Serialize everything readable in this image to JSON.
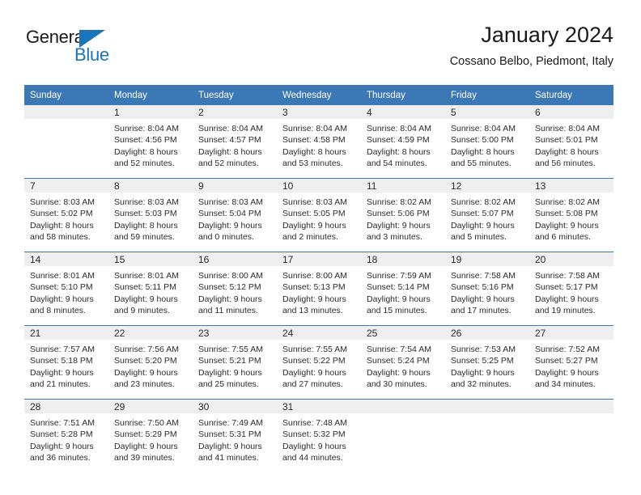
{
  "brand": {
    "name_top": "General",
    "name_bottom": "Blue",
    "accent_color": "#1b75bb"
  },
  "header": {
    "title": "January 2024",
    "subtitle": "Cossano Belbo, Piedmont, Italy"
  },
  "calendar": {
    "header_color": "#3b78b5",
    "daynum_background": "#efefef",
    "weekday_headers": [
      "Sunday",
      "Monday",
      "Tuesday",
      "Wednesday",
      "Thursday",
      "Friday",
      "Saturday"
    ],
    "weeks": [
      [
        {
          "day": "",
          "lines": []
        },
        {
          "day": "1",
          "lines": [
            "Sunrise: 8:04 AM",
            "Sunset: 4:56 PM",
            "Daylight: 8 hours",
            "and 52 minutes."
          ]
        },
        {
          "day": "2",
          "lines": [
            "Sunrise: 8:04 AM",
            "Sunset: 4:57 PM",
            "Daylight: 8 hours",
            "and 52 minutes."
          ]
        },
        {
          "day": "3",
          "lines": [
            "Sunrise: 8:04 AM",
            "Sunset: 4:58 PM",
            "Daylight: 8 hours",
            "and 53 minutes."
          ]
        },
        {
          "day": "4",
          "lines": [
            "Sunrise: 8:04 AM",
            "Sunset: 4:59 PM",
            "Daylight: 8 hours",
            "and 54 minutes."
          ]
        },
        {
          "day": "5",
          "lines": [
            "Sunrise: 8:04 AM",
            "Sunset: 5:00 PM",
            "Daylight: 8 hours",
            "and 55 minutes."
          ]
        },
        {
          "day": "6",
          "lines": [
            "Sunrise: 8:04 AM",
            "Sunset: 5:01 PM",
            "Daylight: 8 hours",
            "and 56 minutes."
          ]
        }
      ],
      [
        {
          "day": "7",
          "lines": [
            "Sunrise: 8:03 AM",
            "Sunset: 5:02 PM",
            "Daylight: 8 hours",
            "and 58 minutes."
          ]
        },
        {
          "day": "8",
          "lines": [
            "Sunrise: 8:03 AM",
            "Sunset: 5:03 PM",
            "Daylight: 8 hours",
            "and 59 minutes."
          ]
        },
        {
          "day": "9",
          "lines": [
            "Sunrise: 8:03 AM",
            "Sunset: 5:04 PM",
            "Daylight: 9 hours",
            "and 0 minutes."
          ]
        },
        {
          "day": "10",
          "lines": [
            "Sunrise: 8:03 AM",
            "Sunset: 5:05 PM",
            "Daylight: 9 hours",
            "and 2 minutes."
          ]
        },
        {
          "day": "11",
          "lines": [
            "Sunrise: 8:02 AM",
            "Sunset: 5:06 PM",
            "Daylight: 9 hours",
            "and 3 minutes."
          ]
        },
        {
          "day": "12",
          "lines": [
            "Sunrise: 8:02 AM",
            "Sunset: 5:07 PM",
            "Daylight: 9 hours",
            "and 5 minutes."
          ]
        },
        {
          "day": "13",
          "lines": [
            "Sunrise: 8:02 AM",
            "Sunset: 5:08 PM",
            "Daylight: 9 hours",
            "and 6 minutes."
          ]
        }
      ],
      [
        {
          "day": "14",
          "lines": [
            "Sunrise: 8:01 AM",
            "Sunset: 5:10 PM",
            "Daylight: 9 hours",
            "and 8 minutes."
          ]
        },
        {
          "day": "15",
          "lines": [
            "Sunrise: 8:01 AM",
            "Sunset: 5:11 PM",
            "Daylight: 9 hours",
            "and 9 minutes."
          ]
        },
        {
          "day": "16",
          "lines": [
            "Sunrise: 8:00 AM",
            "Sunset: 5:12 PM",
            "Daylight: 9 hours",
            "and 11 minutes."
          ]
        },
        {
          "day": "17",
          "lines": [
            "Sunrise: 8:00 AM",
            "Sunset: 5:13 PM",
            "Daylight: 9 hours",
            "and 13 minutes."
          ]
        },
        {
          "day": "18",
          "lines": [
            "Sunrise: 7:59 AM",
            "Sunset: 5:14 PM",
            "Daylight: 9 hours",
            "and 15 minutes."
          ]
        },
        {
          "day": "19",
          "lines": [
            "Sunrise: 7:58 AM",
            "Sunset: 5:16 PM",
            "Daylight: 9 hours",
            "and 17 minutes."
          ]
        },
        {
          "day": "20",
          "lines": [
            "Sunrise: 7:58 AM",
            "Sunset: 5:17 PM",
            "Daylight: 9 hours",
            "and 19 minutes."
          ]
        }
      ],
      [
        {
          "day": "21",
          "lines": [
            "Sunrise: 7:57 AM",
            "Sunset: 5:18 PM",
            "Daylight: 9 hours",
            "and 21 minutes."
          ]
        },
        {
          "day": "22",
          "lines": [
            "Sunrise: 7:56 AM",
            "Sunset: 5:20 PM",
            "Daylight: 9 hours",
            "and 23 minutes."
          ]
        },
        {
          "day": "23",
          "lines": [
            "Sunrise: 7:55 AM",
            "Sunset: 5:21 PM",
            "Daylight: 9 hours",
            "and 25 minutes."
          ]
        },
        {
          "day": "24",
          "lines": [
            "Sunrise: 7:55 AM",
            "Sunset: 5:22 PM",
            "Daylight: 9 hours",
            "and 27 minutes."
          ]
        },
        {
          "day": "25",
          "lines": [
            "Sunrise: 7:54 AM",
            "Sunset: 5:24 PM",
            "Daylight: 9 hours",
            "and 30 minutes."
          ]
        },
        {
          "day": "26",
          "lines": [
            "Sunrise: 7:53 AM",
            "Sunset: 5:25 PM",
            "Daylight: 9 hours",
            "and 32 minutes."
          ]
        },
        {
          "day": "27",
          "lines": [
            "Sunrise: 7:52 AM",
            "Sunset: 5:27 PM",
            "Daylight: 9 hours",
            "and 34 minutes."
          ]
        }
      ],
      [
        {
          "day": "28",
          "lines": [
            "Sunrise: 7:51 AM",
            "Sunset: 5:28 PM",
            "Daylight: 9 hours",
            "and 36 minutes."
          ]
        },
        {
          "day": "29",
          "lines": [
            "Sunrise: 7:50 AM",
            "Sunset: 5:29 PM",
            "Daylight: 9 hours",
            "and 39 minutes."
          ]
        },
        {
          "day": "30",
          "lines": [
            "Sunrise: 7:49 AM",
            "Sunset: 5:31 PM",
            "Daylight: 9 hours",
            "and 41 minutes."
          ]
        },
        {
          "day": "31",
          "lines": [
            "Sunrise: 7:48 AM",
            "Sunset: 5:32 PM",
            "Daylight: 9 hours",
            "and 44 minutes."
          ]
        },
        {
          "day": "",
          "lines": []
        },
        {
          "day": "",
          "lines": []
        },
        {
          "day": "",
          "lines": []
        }
      ]
    ]
  }
}
